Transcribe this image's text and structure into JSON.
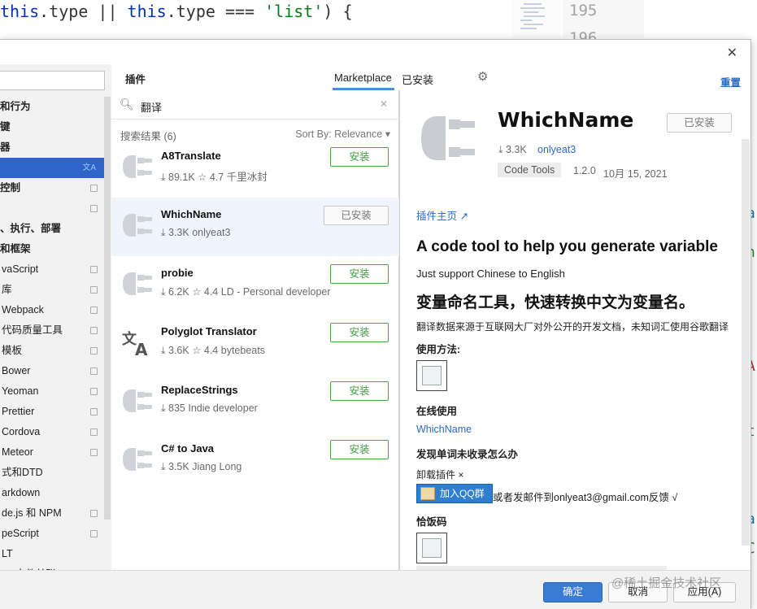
{
  "editor": {
    "code_tokens": [
      "this",
      ".type || ",
      "this",
      ".type === ",
      "'list'",
      ") {"
    ],
    "line_a": "195",
    "line_b": "196",
    "side_marks": [
      "a",
      "n",
      "A",
      "t",
      "a",
      "C"
    ]
  },
  "dialog": {
    "close_label": "✕"
  },
  "settings_nav": {
    "items": [
      {
        "label": "和行为",
        "bold": true
      },
      {
        "label": "键",
        "bold": true
      },
      {
        "label": "器",
        "bold": true
      },
      {
        "label": "",
        "selected": true,
        "icon": "translate-icon"
      },
      {
        "label": "控制",
        "bold": true,
        "proj": true
      },
      {
        "label": "",
        "proj": true
      },
      {
        "label": "、执行、部署",
        "bold": true
      },
      {
        "label": "和框架",
        "bold": true
      },
      {
        "label": "vaScript",
        "proj": true
      },
      {
        "label": "库",
        "proj": true
      },
      {
        "label": "Webpack",
        "proj": true
      },
      {
        "label": "代码质量工具",
        "proj": true
      },
      {
        "label": "模板",
        "proj": true
      },
      {
        "label": "Bower",
        "proj": true
      },
      {
        "label": "Yeoman",
        "proj": true
      },
      {
        "label": "Prettier",
        "proj": true
      },
      {
        "label": "Cordova",
        "proj": true
      },
      {
        "label": "Meteor",
        "proj": true
      },
      {
        "label": "式和DTD",
        "proj": false
      },
      {
        "label": "arkdown",
        "proj": false
      },
      {
        "label": "de.js 和 NPM",
        "proj": true
      },
      {
        "label": "peScript",
        "proj": true
      },
      {
        "label": "LT",
        "proj": false
      },
      {
        "label": "LT 文件关联",
        "proj": true
      }
    ]
  },
  "header": {
    "title": "插件",
    "tab_marketplace": "Marketplace",
    "tab_installed": "已安装",
    "gear_icon": "gear-icon",
    "reset": "重置"
  },
  "search": {
    "query": "翻译",
    "results": "搜索结果 (6)",
    "sort": "Sort By: Relevance ▾"
  },
  "plugins": [
    {
      "name": "A8Translate",
      "downloads": "89.1K",
      "rating": "4.7",
      "author": "千里冰封",
      "button": "安装",
      "installed": false,
      "icon": "plug-icon"
    },
    {
      "name": "WhichName",
      "downloads": "3.3K",
      "rating": "",
      "author": "onlyeat3",
      "button": "已安装",
      "installed": true,
      "icon": "plug-icon"
    },
    {
      "name": "probie",
      "downloads": "6.2K",
      "rating": "4.4",
      "author": "LD - Personal developer",
      "button": "安装",
      "installed": false,
      "icon": "plug-icon"
    },
    {
      "name": "Polyglot Translator",
      "downloads": "3.6K",
      "rating": "4.4",
      "author": "bytebeats",
      "button": "安装",
      "installed": false,
      "icon": "translate-icon"
    },
    {
      "name": "ReplaceStrings",
      "downloads": "835",
      "rating": "",
      "author": "Indie developer",
      "button": "安装",
      "installed": false,
      "icon": "plug-icon"
    },
    {
      "name": "C# to Java",
      "downloads": "3.5K",
      "rating": "",
      "author": "Jiang Long",
      "button": "安装",
      "installed": false,
      "icon": "plug-icon"
    }
  ],
  "detail": {
    "title": "WhichName",
    "installed_button": "已安装",
    "downloads": "⤓ 3.3K",
    "author": "onlyeat3",
    "tag": "Code Tools",
    "version": "1.2.0",
    "date": "10月 15, 2021",
    "homepage": "插件主页 ↗",
    "heading_en": "A code tool to help you generate variable",
    "sub_en": "Just support Chinese to English",
    "heading_cn": "变量命名工具，快速转换中文为变量名。",
    "note": "翻译数据来源于互联网大厂对外公开的开发文档，未知词汇使用谷歌翻译",
    "usage": "使用方法:",
    "online": "在线使用",
    "online_link": "WhichName",
    "missing": "发现单词未收录怎么办",
    "uninstall": "卸载插件 ×",
    "qq": "加入QQ群",
    "feedback": "或者发邮件到onlyeat3@gmail.com反馈 √",
    "garbled": "恰饭码"
  },
  "footer": {
    "ok": "确定",
    "cancel": "取消",
    "apply": "应用(A)",
    "watermark": "@稀土掘金技术社区"
  },
  "colors": {
    "accent": "#3a7bd5",
    "install_green": "#4aa449",
    "link": "#2a6bc2",
    "nav_selected": "#2f65ca"
  }
}
